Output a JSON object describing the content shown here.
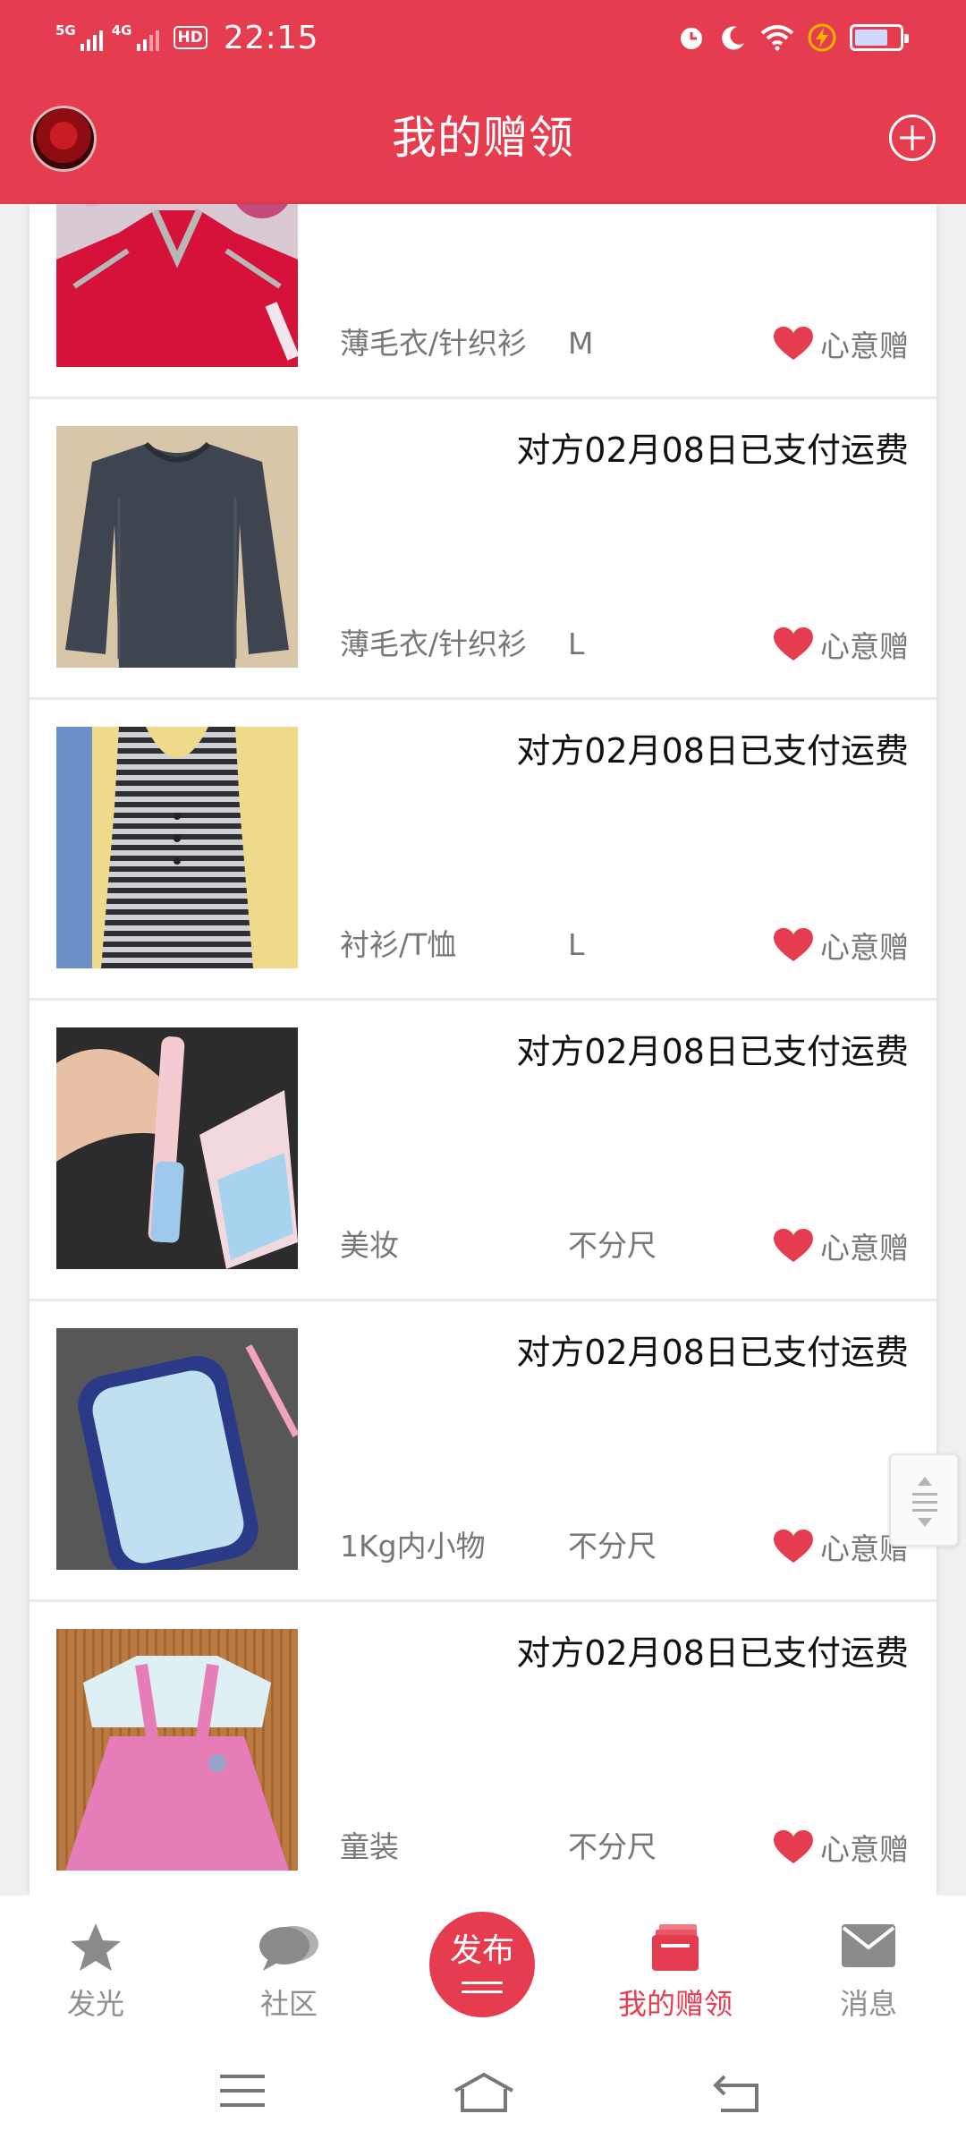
{
  "status_bar": {
    "network_1": "5G",
    "network_2": "4G",
    "hd_label": "HD",
    "time": "22:15",
    "battery_percent": 75
  },
  "header": {
    "title": "我的赠领",
    "avatar_icon": "avatar-red-badge-icon",
    "add_icon": "plus-circle-icon"
  },
  "items": [
    {
      "status": "",
      "category": "薄毛衣/针织衫",
      "size": "M",
      "gift_label": "心意赠",
      "image": "red-sweater"
    },
    {
      "status": "对方02月08日已支付运费",
      "category": "薄毛衣/针织衫",
      "size": "L",
      "gift_label": "心意赠",
      "image": "gray-sweater"
    },
    {
      "status": "对方02月08日已支付运费",
      "category": "衬衫/T恤",
      "size": "L",
      "gift_label": "心意赠",
      "image": "striped-tank"
    },
    {
      "status": "对方02月08日已支付运费",
      "category": "美妆",
      "size": "不分尺",
      "gift_label": "心意赠",
      "image": "mascara"
    },
    {
      "status": "对方02月08日已支付运费",
      "category": "1Kg内小物",
      "size": "不分尺",
      "gift_label": "心意赠",
      "image": "phone-case"
    },
    {
      "status": "对方02月08日已支付运费",
      "category": "童装",
      "size": "不分尺",
      "gift_label": "心意赠",
      "image": "pink-dress"
    }
  ],
  "tabs": [
    {
      "label": "发光",
      "icon": "star-icon",
      "active": false
    },
    {
      "label": "社区",
      "icon": "chat-bubbles-icon",
      "active": false
    },
    {
      "label": "发布",
      "icon": "publish-button",
      "active": false
    },
    {
      "label": "我的赠领",
      "icon": "gift-box-icon",
      "active": true
    },
    {
      "label": "消息",
      "icon": "mail-icon",
      "active": false
    }
  ],
  "colors": {
    "accent": "#e63c4f",
    "inactive": "#8e8e8e",
    "heart": "#e63c4f"
  }
}
